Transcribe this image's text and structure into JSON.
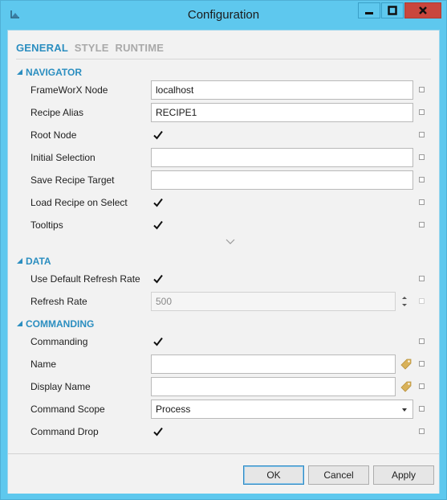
{
  "window": {
    "title": "Configuration"
  },
  "icons": {
    "app": "app-icon",
    "minimize": "minimize-icon",
    "maximize": "maximize-icon",
    "close": "close-icon",
    "section": "collapse-triangle-icon",
    "checkbox": "checkmark-icon",
    "binding": "binding-square-icon",
    "tag": "tag-icon",
    "spinner": "spinner-icon",
    "more": "chevron-down-icon",
    "dropdown": "dropdown-arrow-icon"
  },
  "tabs": [
    {
      "label": "GENERAL",
      "active": true
    },
    {
      "label": "STYLE",
      "active": false
    },
    {
      "label": "RUNTIME",
      "active": false
    }
  ],
  "navigator": {
    "header": "NAVIGATOR",
    "frameworx_node": {
      "label": "FrameWorX Node",
      "value": "localhost"
    },
    "recipe_alias": {
      "label": "Recipe Alias",
      "value": "RECIPE1"
    },
    "root_node": {
      "label": "Root Node",
      "checked": true
    },
    "initial_selection": {
      "label": "Initial Selection",
      "value": ""
    },
    "save_recipe_target": {
      "label": "Save Recipe Target",
      "value": ""
    },
    "load_recipe_on_select": {
      "label": "Load Recipe on Select",
      "checked": true
    },
    "tooltips": {
      "label": "Tooltips",
      "checked": true
    }
  },
  "data_section": {
    "header": "DATA",
    "use_default_refresh_rate": {
      "label": "Use Default Refresh Rate",
      "checked": true
    },
    "refresh_rate": {
      "label": "Refresh Rate",
      "value": "500",
      "enabled": false
    }
  },
  "commanding": {
    "header": "COMMANDING",
    "commanding": {
      "label": "Commanding",
      "checked": true
    },
    "name": {
      "label": "Name",
      "value": ""
    },
    "display_name": {
      "label": "Display Name",
      "value": ""
    },
    "command_scope": {
      "label": "Command Scope",
      "value": "Process"
    },
    "command_drop": {
      "label": "Command Drop",
      "checked": true
    }
  },
  "buttons": {
    "ok": "OK",
    "cancel": "Cancel",
    "apply": "Apply"
  },
  "colors": {
    "titlebar": "#5ec8ee",
    "close": "#c9463d",
    "accent": "#2b8ec0",
    "tab_inactive": "#a9a9a9",
    "tag": "#d9b25a"
  }
}
